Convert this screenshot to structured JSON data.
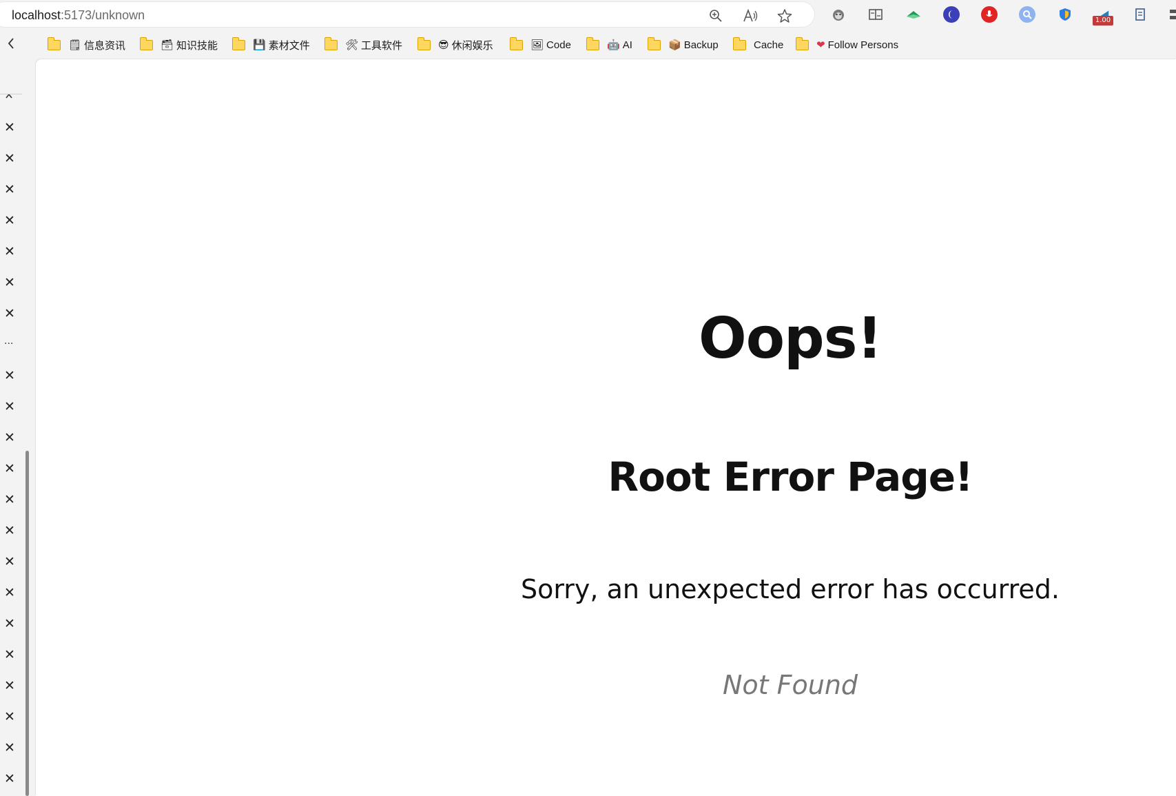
{
  "address_bar": {
    "url_host": "localhost",
    "url_path": ":5173/unknown",
    "icons": [
      "site-info-icon",
      "zoom-icon",
      "read-aloud-icon",
      "favorite-star-icon"
    ]
  },
  "extensions": {
    "items": [
      "monkey-extension-icon",
      "reader-extension-icon",
      "green-leaf-extension-icon",
      "blue-moon-extension-icon",
      "red-record-extension-icon",
      "search-extension-icon",
      "shield-extension-icon",
      "speed-extension-icon",
      "notes-extension-icon"
    ],
    "speed_badge": "1.00"
  },
  "bookmarks": [
    {
      "emoji": "🗒",
      "label": "信息资讯"
    },
    {
      "emoji": "🗃",
      "label": "知识技能"
    },
    {
      "emoji": "💾",
      "label": "素材文件"
    },
    {
      "emoji": "🛠",
      "label": "工具软件"
    },
    {
      "emoji": "😎",
      "label": "休闲娱乐"
    },
    {
      "emoji": "🖼",
      "label": "Code"
    },
    {
      "emoji": "🤖",
      "label": "AI"
    },
    {
      "emoji": "📦",
      "label": "Backup"
    },
    {
      "emoji": "",
      "label": "Cache"
    },
    {
      "emoji": "❤",
      "label": "Follow Persons"
    }
  ],
  "side_panel": {
    "chevron": "^",
    "close_glyph": "✕",
    "ellipsis": "..."
  },
  "page": {
    "title": "Oops!",
    "subtitle": "Root Error Page!",
    "message": "Sorry, an unexpected error has occurred.",
    "status": "Not Found"
  }
}
